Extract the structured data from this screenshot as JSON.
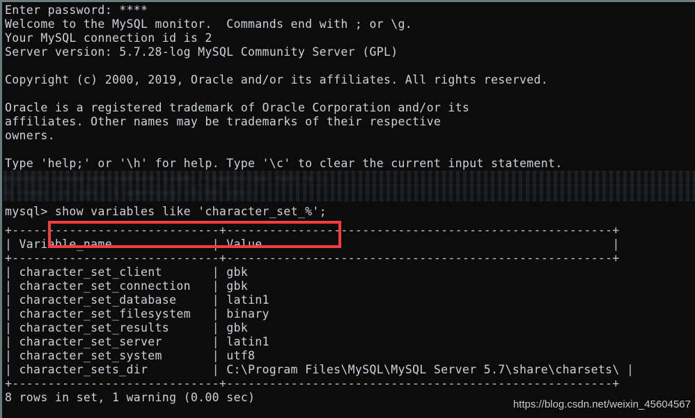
{
  "terminal": {
    "banner_lines": [
      "Enter password: ****",
      "Welcome to the MySQL monitor.  Commands end with ; or \\g.",
      "Your MySQL connection id is 2",
      "Server version: 5.7.28-log MySQL Community Server (GPL)",
      "",
      "Copyright (c) 2000, 2019, Oracle and/or its affiliates. All rights reserved.",
      "",
      "Oracle is a registered trademark of Oracle Corporation and/or its",
      "affiliates. Other names may be trademarks of their respective",
      "owners.",
      "",
      "Type 'help;' or '\\h' for help. Type '\\c' to clear the current input statement."
    ],
    "censored_lines": [
      "mysql> show variables like 'character_set_%';",
      "8 rows in set, 1 warning (0.00 sec)"
    ],
    "prompt": "mysql> ",
    "command": "show variables like 'character_set_%';",
    "result_footer": "8 rows in set, 1 warning (0.00 sec)",
    "highlight_color": "#fa3c3c"
  },
  "table": {
    "top_rule": "+-----------------------------+------------------------------------------------------+",
    "header_rule": "+-----------------------------+------------------------------------------------------+",
    "bottom_rule": "+-----------------------------+------------------------------------------------------+",
    "columns": [
      "Variable_name",
      "Value"
    ],
    "rows": [
      {
        "name": "character_set_client",
        "value": "gbk"
      },
      {
        "name": "character_set_connection",
        "value": "gbk"
      },
      {
        "name": "character_set_database",
        "value": "latin1"
      },
      {
        "name": "character_set_filesystem",
        "value": "binary"
      },
      {
        "name": "character_set_results",
        "value": "gbk"
      },
      {
        "name": "character_set_server",
        "value": "latin1"
      },
      {
        "name": "character_set_system",
        "value": "utf8"
      },
      {
        "name": "character_sets_dir",
        "value": "C:\\Program Files\\MySQL\\MySQL Server 5.7\\share\\charsets\\"
      }
    ]
  },
  "watermark": {
    "text": "https://blog.csdn.net/weixin_45604567"
  }
}
